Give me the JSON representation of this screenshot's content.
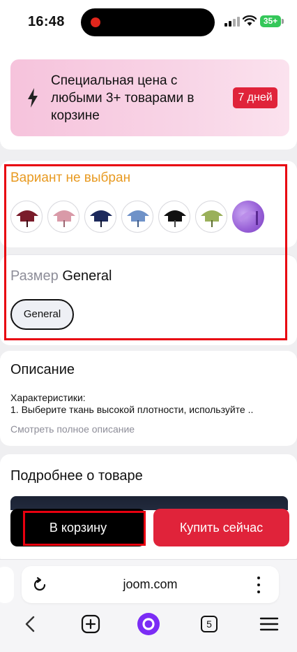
{
  "status_bar": {
    "time": "16:48",
    "battery": "35+"
  },
  "promo": {
    "text": "Специальная цена с любыми 3+ товарами в корзине",
    "badge": "7 дней",
    "icon": "bolt-icon"
  },
  "variant": {
    "title": "Вариант не выбран",
    "swatches": [
      {
        "name": "burgundy",
        "color": "#7a1c2a"
      },
      {
        "name": "pink",
        "color": "#d99aa8"
      },
      {
        "name": "navy",
        "color": "#1d2a5c"
      },
      {
        "name": "light-blue",
        "color": "#6f92c8"
      },
      {
        "name": "black",
        "color": "#111111"
      },
      {
        "name": "olive",
        "color": "#9ab05a"
      },
      {
        "name": "video",
        "color": "#9a63d8"
      }
    ]
  },
  "size": {
    "label": "Размер",
    "value": "General",
    "option": "General"
  },
  "description": {
    "title": "Описание",
    "body_line1": "Характеристики:",
    "body_line2": "1. Выберите ткань высокой плотности, используйте ..",
    "more_link": "Смотреть полное описание"
  },
  "details": {
    "title": "Подробнее о товаре"
  },
  "actions": {
    "cart": "В корзину",
    "buy": "Купить сейчас"
  },
  "browser": {
    "url": "joom.com",
    "tabs_count": "5"
  },
  "colors": {
    "accent_red": "#e0233a",
    "warning_orange": "#e89a21",
    "highlight_red": "#e8000f"
  }
}
